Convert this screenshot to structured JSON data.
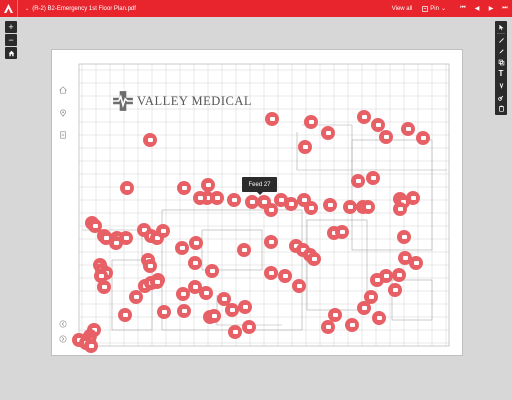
{
  "app": {
    "document_title": "(R-2) B2-Emergency 1st Floor Plan.pdf",
    "view_all_label": "View all",
    "pin_label": "Pin",
    "accent_color": "#e8242d",
    "pin_color": "#e76066"
  },
  "left_toolbar": {
    "zoom_in": "+",
    "zoom_out": "−",
    "home_icon": "home-icon"
  },
  "right_toolbar": {
    "tools": [
      "cursor-icon",
      "line-icon",
      "pencil-icon",
      "copy-icon",
      "text-icon",
      "rotate-icon",
      "link-icon",
      "paste-icon"
    ]
  },
  "canvas": {
    "brand_name": "VALLEY MEDICAL",
    "tooltip_text": "Feed 27"
  }
}
